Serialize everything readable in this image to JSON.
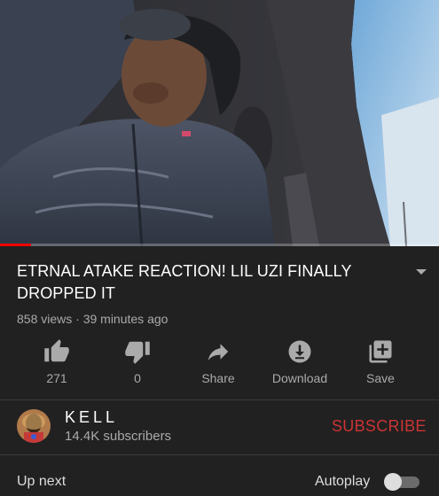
{
  "video": {
    "progress": 0.07
  },
  "title": {
    "text": "ETRNAL ATAKE REACTION!  LIL UZI FINALLY DROPPED IT"
  },
  "meta": {
    "text": "858 views · 39 minutes ago"
  },
  "actions": [
    {
      "label": "271",
      "icon": "thumbs-up-icon"
    },
    {
      "label": "0",
      "icon": "thumbs-down-icon"
    },
    {
      "label": "Share",
      "icon": "share-icon"
    },
    {
      "label": "Download",
      "icon": "download-icon"
    },
    {
      "label": "Save",
      "icon": "add-to-playlist-icon"
    }
  ],
  "channel": {
    "name": "KELL",
    "subscribers": "14.4K subscribers",
    "subscribe_label": "SUBSCRIBE",
    "subscribe_color": "#cc3333"
  },
  "up_next": {
    "label": "Up next",
    "autoplay_label": "Autoplay",
    "autoplay_on": false
  }
}
